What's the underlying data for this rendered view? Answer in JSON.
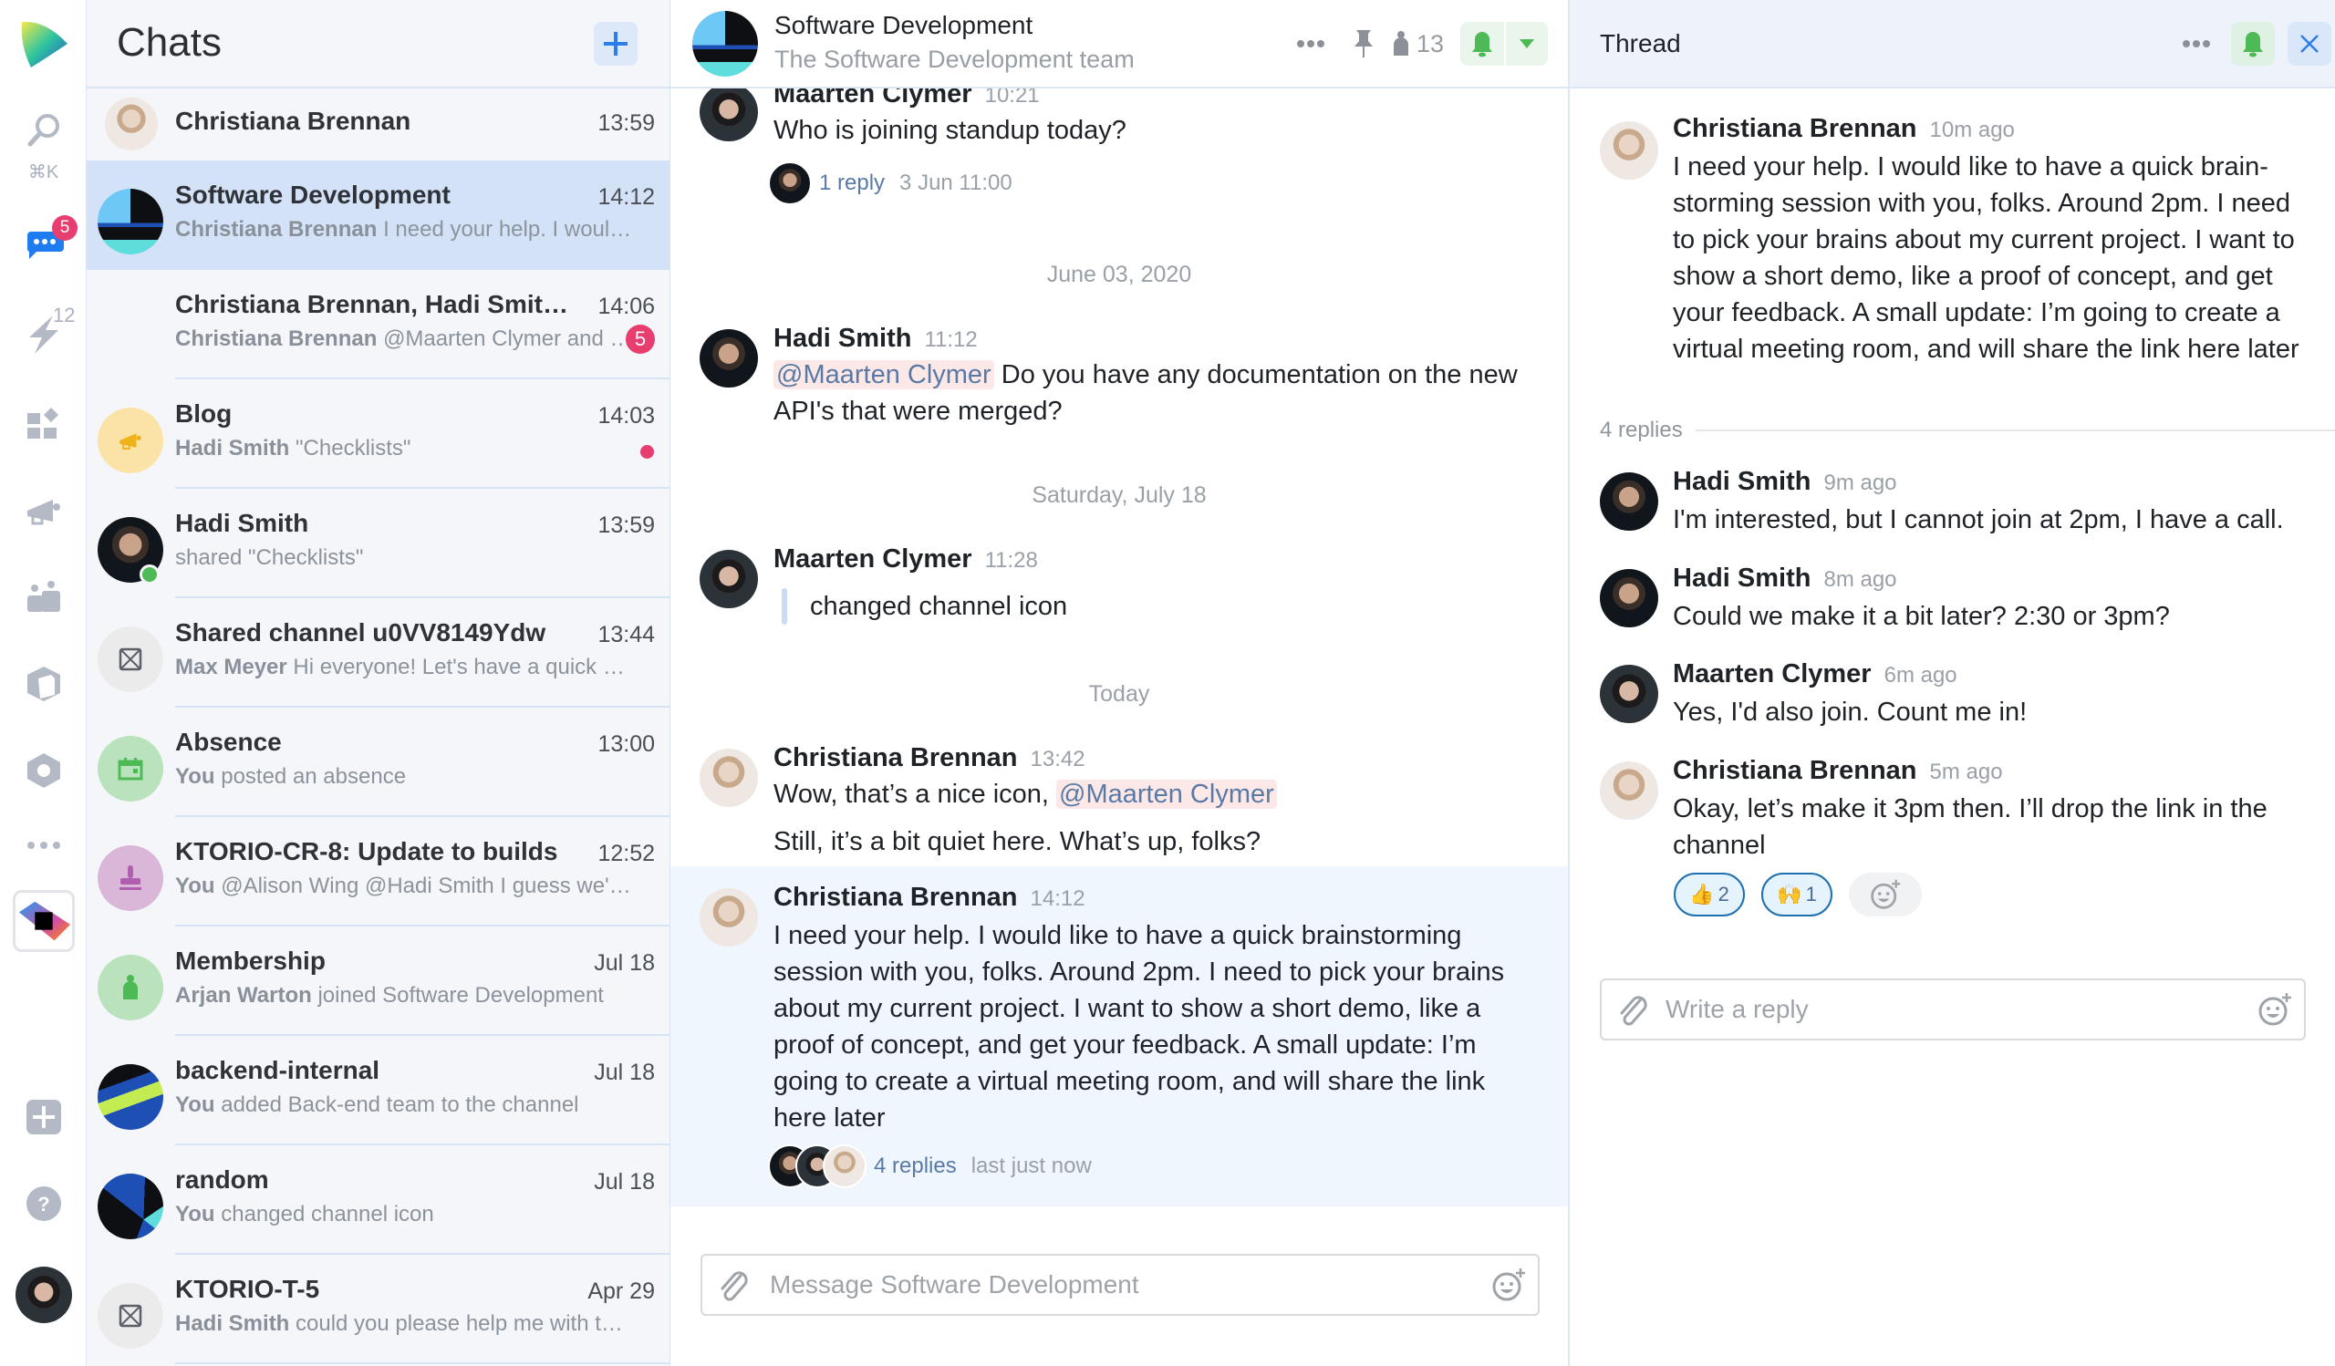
{
  "rail": {
    "search_shortcut": "⌘K",
    "chats_badge": "5",
    "activity_count": "12",
    "items": [
      "logo",
      "search",
      "chats",
      "activity",
      "apps",
      "announcements",
      "teams",
      "packages",
      "settings",
      "more",
      "integration",
      "add",
      "help",
      "profile"
    ]
  },
  "chatlist": {
    "title": "Chats",
    "new_chat_label": "+",
    "items": [
      {
        "name": "Christiana Brennan",
        "time": "13:59",
        "sender": "",
        "preview": "",
        "avatar": "person-christiana"
      },
      {
        "name": "Software Development",
        "time": "14:12",
        "sender": "Christiana Brennan",
        "preview": "I need your help. I would like to have a quick brainstorming session",
        "avatar": "channel-icon",
        "active": true
      },
      {
        "name": "Christiana Brennan, Hadi Smith, Maarten Clymer",
        "time": "14:06",
        "sender": "Christiana Brennan",
        "preview": "@Maarten Clymer and @Hadi Smith",
        "unread": "5",
        "avatar": "group"
      },
      {
        "name": "Blog",
        "time": "14:03",
        "sender": "Hadi Smith",
        "preview": "\"Checklists\"",
        "dot": true,
        "avatar": "megaphone-icon"
      },
      {
        "name": "Hadi Smith",
        "time": "13:59",
        "sender": "",
        "preview": "shared \"Checklists\"",
        "online": true,
        "avatar": "person-hadi"
      },
      {
        "name": "Shared channel u0VV8149Ydw",
        "time": "13:44",
        "sender": "Max Meyer",
        "preview": "Hi everyone! Let's have a quick meeting",
        "avatar": "placeholder-icon"
      },
      {
        "name": "Absence",
        "time": "13:00",
        "sender": "You",
        "preview": "posted an absence",
        "avatar": "calendar-icon"
      },
      {
        "name": "KTORIO-CR-8: Update to builds",
        "time": "12:52",
        "sender": "You",
        "preview": "@Alison Wing @Hadi Smith I guess we'll need",
        "avatar": "stamp-icon"
      },
      {
        "name": "Membership",
        "time": "Jul 18",
        "sender": "Arjan Warton",
        "preview": "joined Software Development",
        "avatar": "person-icon"
      },
      {
        "name": "backend-internal",
        "time": "Jul 18",
        "sender": "You",
        "preview": "added Back-end team to the channel",
        "avatar": "channel-icon-backend"
      },
      {
        "name": "random",
        "time": "Jul 18",
        "sender": "You",
        "preview": "changed channel icon",
        "avatar": "channel-icon-random"
      },
      {
        "name": "KTORIO-T-5",
        "time": "Apr 29",
        "sender": "Hadi Smith",
        "preview": "could you please help me with this task",
        "avatar": "placeholder-icon"
      }
    ]
  },
  "main": {
    "channel_title": "Software Development",
    "channel_desc": "The Software Development team",
    "member_count": "13",
    "messages": [
      {
        "author": "Maarten Clymer",
        "time": "10:21",
        "text": "Who is joining standup today?",
        "reply_link": "1 reply",
        "reply_meta": "3 Jun 11:00"
      },
      {
        "date": "June 03, 2020"
      },
      {
        "author": "Hadi Smith",
        "time": "11:12",
        "mention": "@Maarten Clymer",
        "text": " Do you have any documentation on the new API's that were merged?"
      },
      {
        "date": "Saturday, July 18"
      },
      {
        "author": "Maarten Clymer",
        "time": "11:28",
        "text": "changed channel icon"
      },
      {
        "date": "Today"
      },
      {
        "author": "Christiana Brennan",
        "time": "13:42",
        "text": "Wow, that’s a nice icon, ",
        "mention": "@Maarten Clymer",
        "text2": "Still, it’s a bit quiet here. What’s up, folks?"
      },
      {
        "author": "Christiana Brennan",
        "time": "14:12",
        "text": "I need your help. I would like to have a quick brainstorming session with you, folks. Around 2pm. I need to pick your brains about my current project. I want to show a short demo, like a proof of concept, and get your feedback. A small update: I’m going to create a virtual meeting room, and will share the link here later",
        "reply_link": "4 replies",
        "reply_meta": "last just now"
      }
    ],
    "composer_placeholder": "Message Software Development"
  },
  "thread": {
    "title": "Thread",
    "root": {
      "author": "Christiana Brennan",
      "time": "10m ago",
      "text": "I need your help. I would like to have a quick brain-storming session with you, folks. Around 2pm. I need to pick your brains about my current project. I want to show a short demo, like a proof of concept, and get your feedback. A small update: I’m going to create a virtual meeting room, and will share the link here later"
    },
    "replies_label": "4 replies",
    "replies": [
      {
        "author": "Hadi Smith",
        "time": "9m ago",
        "text": "I'm interested, but I cannot join at 2pm, I have a call."
      },
      {
        "author": "Hadi Smith",
        "time": "8m ago",
        "text": "Could we make it a bit later? 2:30 or 3pm?"
      },
      {
        "author": "Maarten Clymer",
        "time": "6m ago",
        "text": "Yes, I'd also join. Count me in!"
      },
      {
        "author": "Christiana Brennan",
        "time": "5m ago",
        "text": "Okay, let’s make it 3pm then. I’ll drop the link in the channel"
      }
    ],
    "reactions": [
      {
        "emoji": "👍",
        "count": "2"
      },
      {
        "emoji": "🙌",
        "count": "1"
      }
    ],
    "reply_placeholder": "Write a reply"
  },
  "colors": {
    "accent": "#2b7de9",
    "badge": "#e83e6f",
    "online": "#4dba55",
    "active_chat": "#d4e2f7",
    "bell": "#4dba55"
  }
}
